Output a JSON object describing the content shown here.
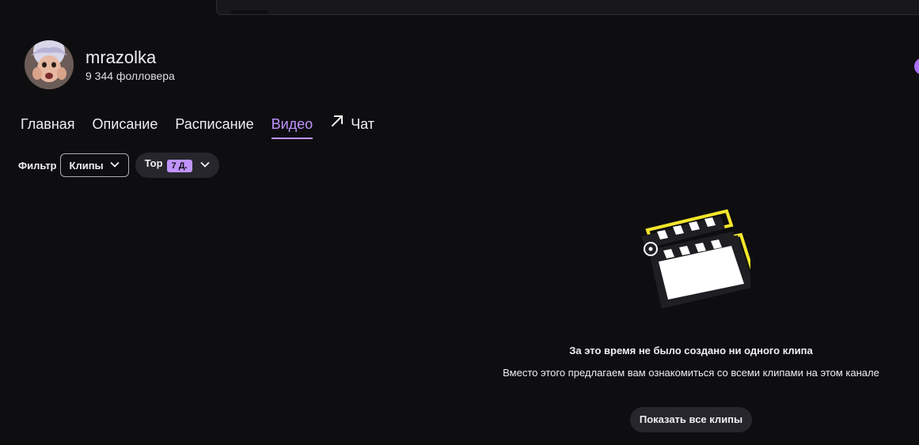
{
  "channel": {
    "name": "mrazolka",
    "followers": "9 344 фолловера"
  },
  "tabs": [
    {
      "label": "Главная",
      "active": false
    },
    {
      "label": "Описание",
      "active": false
    },
    {
      "label": "Расписание",
      "active": false
    },
    {
      "label": "Видео",
      "active": true
    },
    {
      "label": "Чат",
      "active": false,
      "icon": "external-arrow-icon"
    }
  ],
  "filters": {
    "label": "Фильтр",
    "type_value": "Клипы",
    "sort_value": "Top",
    "period_badge": "7 Д."
  },
  "empty_state": {
    "icon": "clapperboard-icon",
    "title": "За это время не было создано ни одного клипа",
    "subtitle": "Вместо этого предлагаем вам ознакомиться со всеми клипами на этом канале",
    "button_label": "Показать все клипы"
  },
  "colors": {
    "background": "#0e0e10",
    "accent": "#bf94ff",
    "button_bg": "#26262c",
    "text": "#efeff1"
  }
}
